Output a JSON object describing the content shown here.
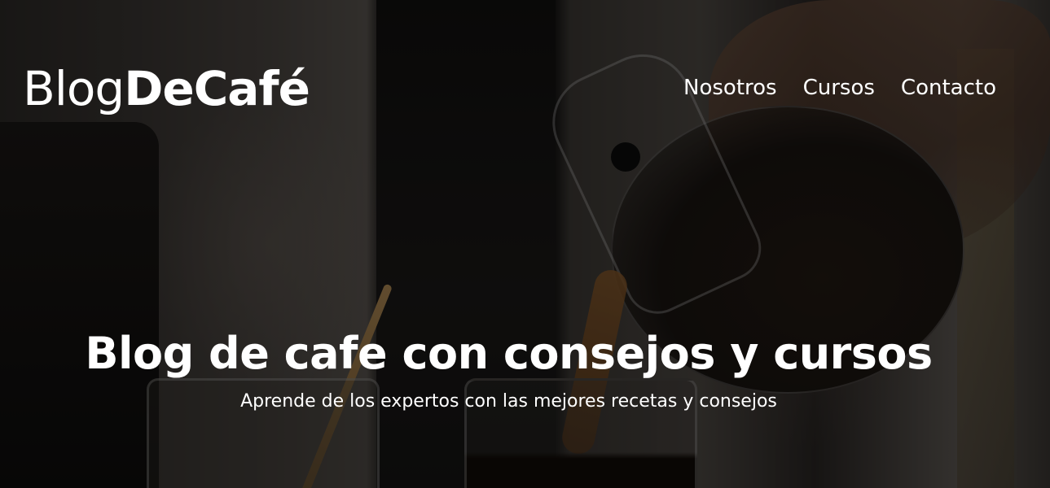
{
  "header": {
    "logo_light": "Blog",
    "logo_bold": "DeCafé",
    "nav": [
      {
        "label": "Nosotros"
      },
      {
        "label": "Cursos"
      },
      {
        "label": "Contacto"
      }
    ]
  },
  "hero": {
    "title": "Blog de cafe con consejos y cursos",
    "subtitle": "Aprende de los expertos con las mejores recetas y consejos",
    "background_image": "coffee-pouring-photo"
  }
}
